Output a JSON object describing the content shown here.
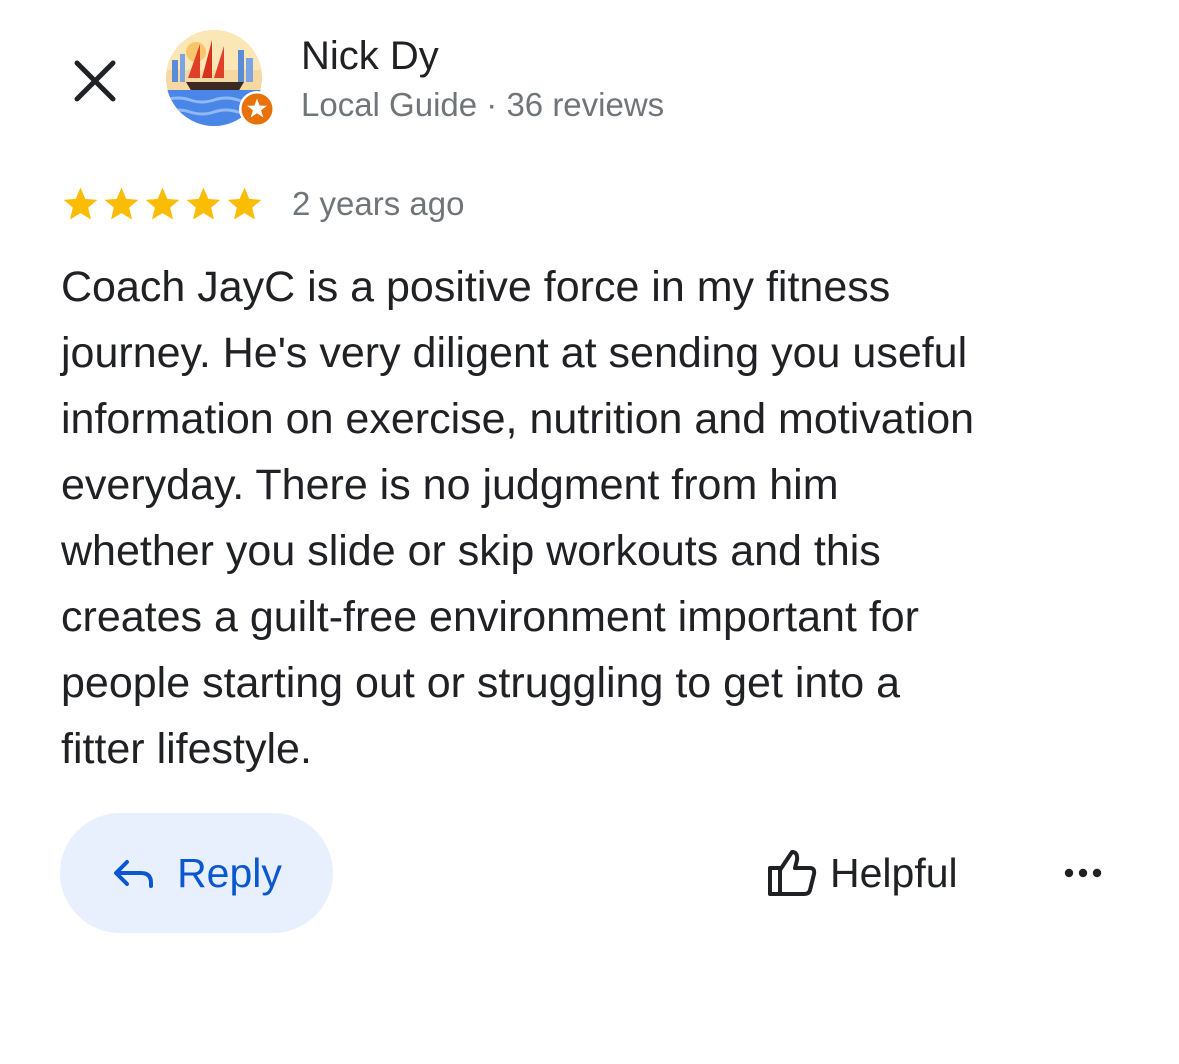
{
  "header": {
    "close_icon": "close-icon",
    "reviewer_name": "Nick Dy",
    "reviewer_meta": "Local Guide · 36 reviews",
    "avatar_badge_icon": "local-guide-star-icon"
  },
  "review": {
    "rating": 5,
    "rating_max": 5,
    "star_color": "#fbbc04",
    "age": "2 years ago",
    "text": "Coach JayC is a positive force in my fitness\njourney. He's very diligent at sending you useful\ninformation on exercise, nutrition and motivation\neveryday. There is no judgment from him\nwhether you slide or skip workouts and this\ncreates a guilt-free environment important for\npeople starting out or struggling to get into a\nfitter lifestyle."
  },
  "actions": {
    "reply_label": "Reply",
    "reply_icon": "reply-arrow-icon",
    "helpful_label": "Helpful",
    "helpful_icon": "thumbs-up-icon",
    "more_icon": "more-horizontal-icon"
  },
  "colors": {
    "accent_blue": "#0b57d0",
    "reply_bg": "#e8f0fe",
    "secondary_text": "#70757a",
    "badge_orange": "#e8710a"
  }
}
